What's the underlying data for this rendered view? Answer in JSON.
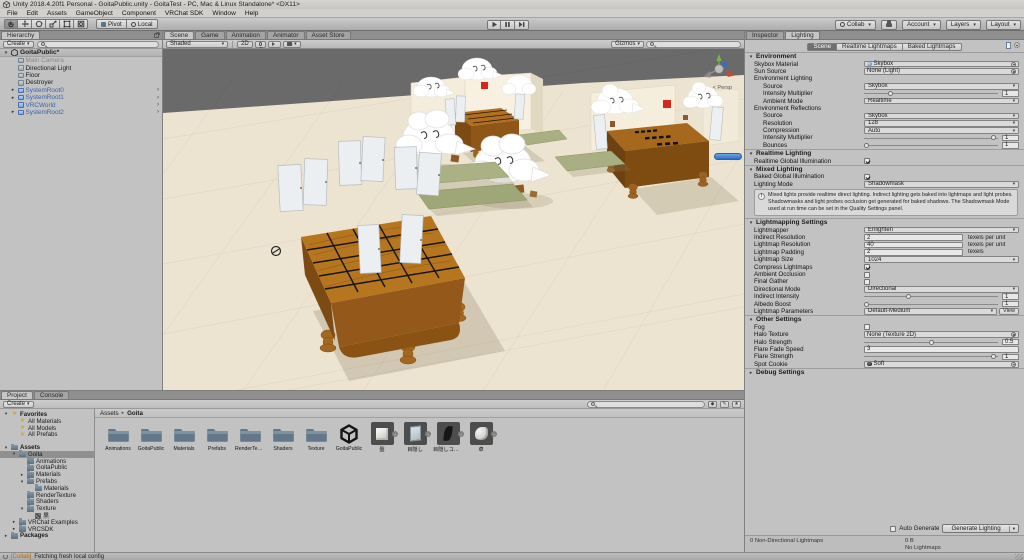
{
  "window": {
    "title": "Unity 2018.4.20f1 Personal - GoitaPublic.unity - GoitaTest - PC, Mac & Linux Standalone* <DX11>"
  },
  "menu": {
    "items": [
      "File",
      "Edit",
      "Assets",
      "GameObject",
      "Component",
      "VRChat SDK",
      "Window",
      "Help"
    ]
  },
  "toolbar": {
    "pivot": "Pivot",
    "local": "Local",
    "collab": "Collab",
    "account": "Account",
    "layers": "Layers",
    "layout": "Layout"
  },
  "hierarchy": {
    "tab": "Hierarchy",
    "create": "Create",
    "search_placeholder": "",
    "scene_root": "GoitaPublic*",
    "items": [
      {
        "label": "Main Camera",
        "style": "disabled",
        "expander": false,
        "nav": false
      },
      {
        "label": "Directional Light",
        "style": "normal",
        "expander": false,
        "nav": false
      },
      {
        "label": "Floor",
        "style": "normal",
        "expander": false,
        "nav": false
      },
      {
        "label": "Destroyer",
        "style": "normal",
        "expander": false,
        "nav": false
      },
      {
        "label": "SystemRoot0",
        "style": "prefab",
        "expander": true,
        "nav": true
      },
      {
        "label": "SystemRoot1",
        "style": "prefab",
        "expander": true,
        "nav": true
      },
      {
        "label": "VRCWorld",
        "style": "prefab",
        "expander": false,
        "nav": true
      },
      {
        "label": "SystemRoot2",
        "style": "prefab",
        "expander": true,
        "nav": true
      }
    ]
  },
  "scene_view": {
    "tabs": [
      {
        "label": "Scene",
        "active": true
      },
      {
        "label": "Game",
        "active": false
      },
      {
        "label": "Animation",
        "active": false
      },
      {
        "label": "Animator",
        "active": false
      },
      {
        "label": "Asset Store",
        "active": false
      }
    ],
    "shading": "Shaded",
    "toggle_2d": "2D",
    "gizmos": "Gizmos",
    "search_placeholder": "",
    "persp": "< Persp"
  },
  "inspector": {
    "tabs": [
      {
        "label": "Inspector",
        "active": false
      },
      {
        "label": "Lighting",
        "active": true
      }
    ]
  },
  "lighting": {
    "sub_tabs": [
      {
        "label": "Scene",
        "active": true
      },
      {
        "label": "Realtime Lightmaps",
        "active": false
      },
      {
        "label": "Baked Lightmaps",
        "active": false
      }
    ],
    "sections": [
      {
        "title": "Environment",
        "collapsed": false,
        "rows": [
          {
            "label": "Skybox Material",
            "type": "object",
            "value": "Skybox",
            "icon": "material"
          },
          {
            "label": "Sun Source",
            "type": "object",
            "value": "None (Light)",
            "icon": "none"
          },
          {
            "label": "Environment Lighting",
            "type": "subheader"
          },
          {
            "label": "Source",
            "type": "dropdown",
            "value": "Skybox",
            "indent": 1
          },
          {
            "label": "Intensity Multiplier",
            "type": "slider",
            "value": "1",
            "pos": 20,
            "indent": 1
          },
          {
            "label": "Ambient Mode",
            "type": "dropdown",
            "value": "Realtime",
            "indent": 1
          },
          {
            "label": "Environment Reflections",
            "type": "subheader"
          },
          {
            "label": "Source",
            "type": "dropdown",
            "value": "Skybox",
            "indent": 1
          },
          {
            "label": "Resolution",
            "type": "dropdown",
            "value": "128",
            "indent": 1
          },
          {
            "label": "Compression",
            "type": "dropdown",
            "value": "Auto",
            "indent": 1
          },
          {
            "label": "Intensity Multiplier",
            "type": "slider",
            "value": "1",
            "pos": 97,
            "indent": 1
          },
          {
            "label": "Bounces",
            "type": "slider",
            "value": "1",
            "pos": 2,
            "indent": 1
          }
        ]
      },
      {
        "title": "Realtime Lighting",
        "collapsed": false,
        "rows": [
          {
            "label": "Realtime Global Illumination",
            "type": "checkbox",
            "checked": true
          }
        ]
      },
      {
        "title": "Mixed Lighting",
        "collapsed": false,
        "rows": [
          {
            "label": "Baked Global Illumination",
            "type": "checkbox",
            "checked": true
          },
          {
            "label": "Lighting Mode",
            "type": "dropdown",
            "value": "Shadowmask"
          },
          {
            "type": "infobox",
            "text": "Mixed lights provide realtime direct lighting. Indirect lighting gets baked into lightmaps and light probes. Shadowmasks and light probes occlusion get generated for baked shadows. The Shadowmask Mode used at run time can be set in the Quality Settings panel."
          }
        ]
      },
      {
        "title": "Lightmapping Settings",
        "collapsed": false,
        "rows": [
          {
            "label": "Lightmapper",
            "type": "dropdown",
            "value": "Enlighten"
          },
          {
            "label": "Indirect Resolution",
            "type": "textfield",
            "value": "2",
            "suffix": "texels per unit"
          },
          {
            "label": "Lightmap Resolution",
            "type": "textfield",
            "value": "40",
            "suffix": "texels per unit"
          },
          {
            "label": "Lightmap Padding",
            "type": "textfield",
            "value": "2",
            "suffix": "texels"
          },
          {
            "label": "Lightmap Size",
            "type": "dropdown",
            "value": "1024"
          },
          {
            "label": "Compress Lightmaps",
            "type": "checkbox",
            "checked": true
          },
          {
            "label": "Ambient Occlusion",
            "type": "checkbox",
            "checked": false
          },
          {
            "label": "Final Gather",
            "type": "checkbox",
            "checked": false
          },
          {
            "label": "Directional Mode",
            "type": "dropdown",
            "value": "Directional"
          },
          {
            "label": "Indirect Intensity",
            "type": "slider",
            "value": "1",
            "pos": 33
          },
          {
            "label": "Albedo Boost",
            "type": "slider",
            "value": "1",
            "pos": 2
          },
          {
            "label": "Lightmap Parameters",
            "type": "dropdown",
            "value": "Default-Medium",
            "extra": "View"
          }
        ]
      },
      {
        "title": "Other Settings",
        "collapsed": false,
        "rows": [
          {
            "label": "Fog",
            "type": "checkbox",
            "checked": false
          },
          {
            "label": "Halo Texture",
            "type": "object",
            "value": "None (Texture 2D)",
            "icon": "none"
          },
          {
            "label": "Halo Strength",
            "type": "slider",
            "value": "0.5",
            "pos": 50
          },
          {
            "label": "Flare Fade Speed",
            "type": "textfield",
            "value": "3"
          },
          {
            "label": "Flare Strength",
            "type": "slider",
            "value": "1",
            "pos": 97
          },
          {
            "label": "Spot Cookie",
            "type": "object",
            "value": "Soft",
            "icon": "texture"
          }
        ]
      },
      {
        "title": "Debug Settings",
        "collapsed": true,
        "rows": []
      }
    ],
    "footer": {
      "auto_generate": "Auto Generate",
      "generate": "Generate Lighting"
    },
    "stats": {
      "left": "0 Non-Directional Lightmaps",
      "size": "0 B",
      "status": "No Lightmaps"
    }
  },
  "project": {
    "tabs": [
      {
        "label": "Project",
        "active": true
      },
      {
        "label": "Console",
        "active": false
      }
    ],
    "create": "Create",
    "search_placeholder": "",
    "favorites": {
      "label": "Favorites",
      "items": [
        "All Materials",
        "All Models",
        "All Prefabs"
      ]
    },
    "tree": [
      {
        "label": "Assets",
        "indent": 0,
        "expand": "open",
        "icon": "folder",
        "bold": true
      },
      {
        "label": "Goita",
        "indent": 1,
        "expand": "open",
        "icon": "folder",
        "selected": true
      },
      {
        "label": "Animations",
        "indent": 2,
        "expand": "none",
        "icon": "folder"
      },
      {
        "label": "GoitaPublic",
        "indent": 2,
        "expand": "none",
        "icon": "folder"
      },
      {
        "label": "Materials",
        "indent": 2,
        "expand": "closed",
        "icon": "folder"
      },
      {
        "label": "Prefabs",
        "indent": 2,
        "expand": "open",
        "icon": "folder"
      },
      {
        "label": "Materials",
        "indent": 3,
        "expand": "none",
        "icon": "folder"
      },
      {
        "label": "RenderTexture",
        "indent": 2,
        "expand": "none",
        "icon": "folder"
      },
      {
        "label": "Shaders",
        "indent": 2,
        "expand": "none",
        "icon": "folder"
      },
      {
        "label": "Texture",
        "indent": 2,
        "expand": "open",
        "icon": "folder"
      },
      {
        "label": "黒",
        "indent": 3,
        "expand": "none",
        "icon": "tex"
      },
      {
        "label": "VRChat Examples",
        "indent": 1,
        "expand": "closed",
        "icon": "folder"
      },
      {
        "label": "VRCSDK",
        "indent": 1,
        "expand": "closed",
        "icon": "folder"
      },
      {
        "label": "Packages",
        "indent": 0,
        "expand": "closed",
        "icon": "folder",
        "bold": true
      }
    ],
    "breadcrumb": {
      "root": "Assets",
      "current": "Goita"
    },
    "grid": [
      {
        "label": "Animations",
        "type": "folder"
      },
      {
        "label": "GoitaPublic",
        "type": "folder"
      },
      {
        "label": "Materials",
        "type": "folder"
      },
      {
        "label": "Prefabs",
        "type": "folder"
      },
      {
        "label": "RenderTextu...",
        "type": "folder"
      },
      {
        "label": "Shaders",
        "type": "folder"
      },
      {
        "label": "Texture",
        "type": "folder"
      },
      {
        "label": "GoitaPublic",
        "type": "unity"
      },
      {
        "label": "盤",
        "type": "cube",
        "nav": true
      },
      {
        "label": "目隠し",
        "type": "panel",
        "nav": true
      },
      {
        "label": "目隠しコライ...",
        "type": "dark",
        "nav": true
      },
      {
        "label": "卓",
        "type": "carved",
        "nav": true
      }
    ]
  },
  "status_bar": {
    "tag": "[Collab]",
    "message": "Fetching fresh local config"
  },
  "icons": {
    "search": "magnifier",
    "dropdown_arrow": "▾",
    "expander_open": "▾",
    "expander_closed": "▸",
    "nav_arrow": "›",
    "info": "!",
    "scene_gizmo": "axis-tripod"
  },
  "colors": {
    "prefab_blue": "#3d62a8",
    "selection_grey": "#909090",
    "wood": "#b5761f",
    "tatami": "#a9af82",
    "alert_red": "#d9251d",
    "collab_orange": "#c06a00",
    "progress_blue": "#2e6fc2"
  }
}
